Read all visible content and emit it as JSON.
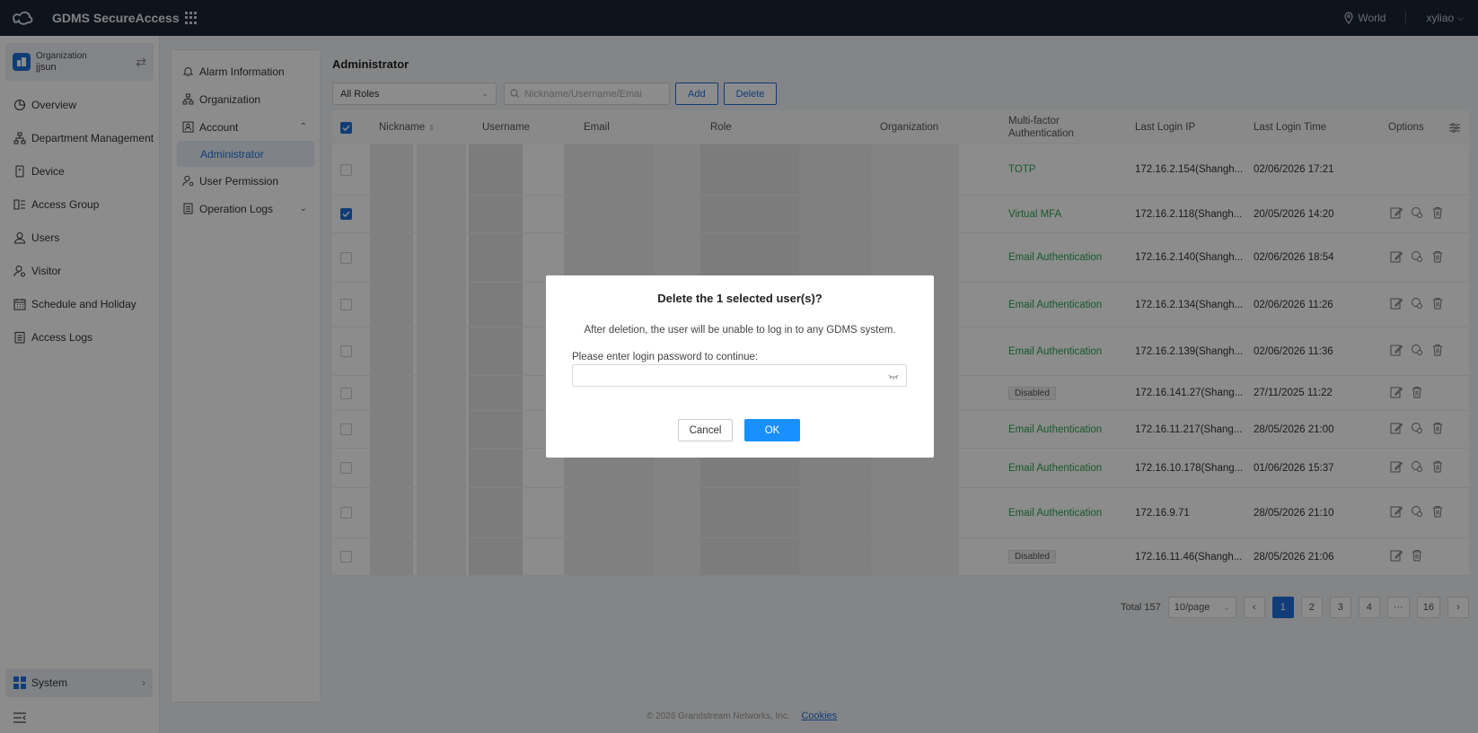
{
  "topbar": {
    "app_title": "GDMS SecureAccess",
    "region": "World",
    "user": "xyliao"
  },
  "sidebar": {
    "org_label": "Organization",
    "org_name": "jjsun",
    "items": [
      {
        "label": "Overview"
      },
      {
        "label": "Department Management"
      },
      {
        "label": "Device"
      },
      {
        "label": "Access Group"
      },
      {
        "label": "Users"
      },
      {
        "label": "Visitor"
      },
      {
        "label": "Schedule and Holiday"
      },
      {
        "label": "Access Logs"
      }
    ],
    "system_label": "System"
  },
  "subnav": {
    "alarm": "Alarm Information",
    "organization": "Organization",
    "account": "Account",
    "administrator": "Administrator",
    "user_permission": "User Permission",
    "operation_logs": "Operation Logs"
  },
  "main": {
    "title": "Administrator",
    "roles_select": "All Roles",
    "search_placeholder": "Nickname/Username/Emai",
    "add_label": "Add",
    "delete_label": "Delete"
  },
  "table": {
    "headers": {
      "nickname": "Nickname",
      "username": "Username",
      "email": "Email",
      "role": "Role",
      "organization": "Organization",
      "mfa_line1": "Multi-factor",
      "mfa_line2": "Authentication",
      "last_ip": "Last Login IP",
      "last_time": "Last Login Time",
      "options": "Options"
    },
    "rows": [
      {
        "mfa": "TOTP",
        "ip": "172.16.2.154(Shangh...",
        "time": "02/06/2026 17:21"
      },
      {
        "mfa": "Virtual MFA",
        "ip": "172.16.2.118(Shangh...",
        "time": "20/05/2026 14:20"
      },
      {
        "mfa": "Email Authentication",
        "ip": "172.16.2.140(Shangh...",
        "time": "02/06/2026 18:54"
      },
      {
        "mfa": "Email Authentication",
        "ip": "172.16.2.134(Shangh...",
        "time": "02/06/2026 11:26"
      },
      {
        "mfa": "Email Authentication",
        "ip": "172.16.2.139(Shangh...",
        "time": "02/06/2026 11:36"
      },
      {
        "mfa": "Disabled",
        "ip": "172.16.141.27(Shang...",
        "time": "27/11/2025 11:22"
      },
      {
        "mfa": "Email Authentication",
        "ip": "172.16.11.217(Shang...",
        "time": "28/05/2026 21:00"
      },
      {
        "mfa": "Email Authentication",
        "ip": "172.16.10.178(Shang...",
        "time": "01/06/2026 15:37"
      },
      {
        "mfa": "Email Authentication",
        "ip": "172.16.9.71",
        "time": "28/05/2026 21:10"
      },
      {
        "mfa": "Disabled",
        "ip": "172.16.11.46(Shangh...",
        "time": "28/05/2026 21:06"
      }
    ]
  },
  "pagination": {
    "total": "Total 157",
    "page_size": "10/page",
    "pages": [
      "1",
      "2",
      "3",
      "4",
      "···",
      "16"
    ],
    "current": "1"
  },
  "footer": {
    "copyright": "© 2026 Grandstream Networks, Inc.",
    "cookies": "Cookies"
  },
  "modal": {
    "title": "Delete the 1 selected user(s)?",
    "description": "After deletion, the user will be unable to log in to any GDMS system.",
    "password_label": "Please enter login password to continue:",
    "password_value": "",
    "cancel_label": "Cancel",
    "ok_label": "OK"
  },
  "colors": {
    "accent": "#1e6fd9",
    "ok_button": "#1890ff",
    "mfa_green": "#2aa44f",
    "topbar": "#1d2433"
  }
}
